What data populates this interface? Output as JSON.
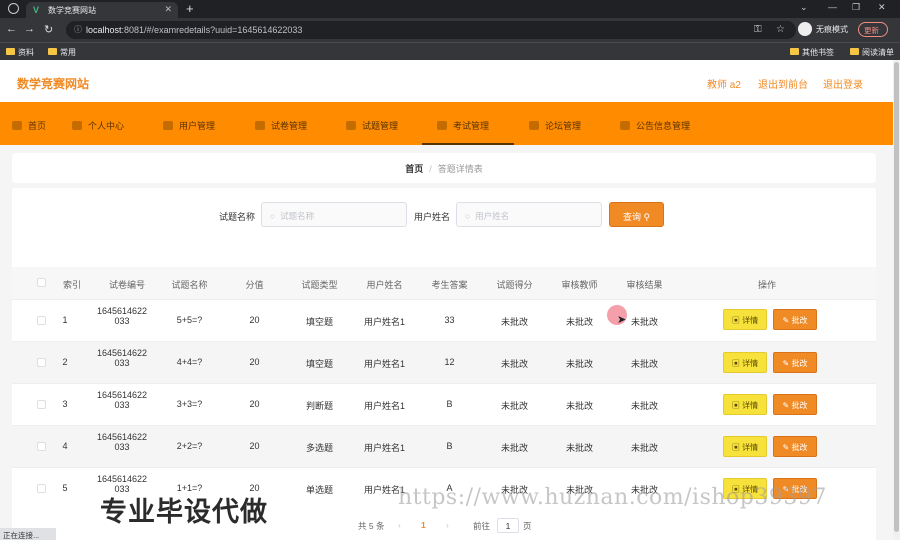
{
  "browser": {
    "tab_title": "数学竞赛网站",
    "url_host": "localhost",
    "url_path": ":8081/#/examredetails?uuid=1645614622033",
    "incognito_label": "无痕模式",
    "update_label": "更新",
    "bookmarks": [
      "资料",
      "常用"
    ],
    "bookmarks_right": [
      "其他书签",
      "阅读清单"
    ]
  },
  "header": {
    "brand": "数学竞赛网站",
    "user_label": "教师 a2",
    "back_front": "退出到前台",
    "logout": "退出登录"
  },
  "menu": {
    "items": [
      {
        "label": "首页",
        "icon": "home-icon"
      },
      {
        "label": "个人中心",
        "icon": "user-icon"
      },
      {
        "label": "用户管理",
        "icon": "users-icon"
      },
      {
        "label": "试卷管理",
        "icon": "paper-icon"
      },
      {
        "label": "试题管理",
        "icon": "question-icon"
      },
      {
        "label": "考试管理",
        "icon": "exam-icon"
      },
      {
        "label": "论坛管理",
        "icon": "forum-icon"
      },
      {
        "label": "公告信息管理",
        "icon": "notice-icon"
      }
    ],
    "active_index": 5
  },
  "breadcrumb": {
    "home": "首页",
    "separator": "/",
    "current": "答题详情表"
  },
  "search": {
    "question_label": "试题名称",
    "question_placeholder": "试题名称",
    "user_label": "用户姓名",
    "user_placeholder": "用户姓名",
    "query_button": "查询"
  },
  "table": {
    "headers": [
      "索引",
      "试卷编号",
      "试题名称",
      "分值",
      "试题类型",
      "用户姓名",
      "考生答案",
      "试题得分",
      "审核教师",
      "审核结果",
      "操作"
    ],
    "rows": [
      {
        "index": "1",
        "paper_no_1": "1645614622",
        "paper_no_2": "033",
        "question": "5+5=?",
        "score": "20",
        "type": "填空题",
        "user": "用户姓名1",
        "answer": "33",
        "got": "未批改",
        "teacher": "未批改",
        "result": "未批改"
      },
      {
        "index": "2",
        "paper_no_1": "1645614622",
        "paper_no_2": "033",
        "question": "4+4=?",
        "score": "20",
        "type": "填空题",
        "user": "用户姓名1",
        "answer": "12",
        "got": "未批改",
        "teacher": "未批改",
        "result": "未批改"
      },
      {
        "index": "3",
        "paper_no_1": "1645614622",
        "paper_no_2": "033",
        "question": "3+3=?",
        "score": "20",
        "type": "判断题",
        "user": "用户姓名1",
        "answer": "B",
        "got": "未批改",
        "teacher": "未批改",
        "result": "未批改"
      },
      {
        "index": "4",
        "paper_no_1": "1645614622",
        "paper_no_2": "033",
        "question": "2+2=?",
        "score": "20",
        "type": "多选题",
        "user": "用户姓名1",
        "answer": "B",
        "got": "未批改",
        "teacher": "未批改",
        "result": "未批改"
      },
      {
        "index": "5",
        "paper_no_1": "1645614622",
        "paper_no_2": "033",
        "question": "1+1=?",
        "score": "20",
        "type": "单选题",
        "user": "用户姓名1",
        "answer": "A",
        "got": "未批改",
        "teacher": "未批改",
        "result": "未批改"
      }
    ],
    "detail_button": "详情",
    "review_button": "批改"
  },
  "pagination": {
    "total": "共 5 条",
    "current_page": "1",
    "goto_label": "前往",
    "goto_value": "1",
    "page_suffix": "页"
  },
  "status_text": "正在连接...",
  "watermark": {
    "url": "https://www.huzhan.com/ishop39397",
    "text": "专业毕设代做"
  },
  "colors": {
    "accent": "#f08a24",
    "menu_bg": "#ff8c00",
    "detail_btn": "#f7e13b"
  }
}
